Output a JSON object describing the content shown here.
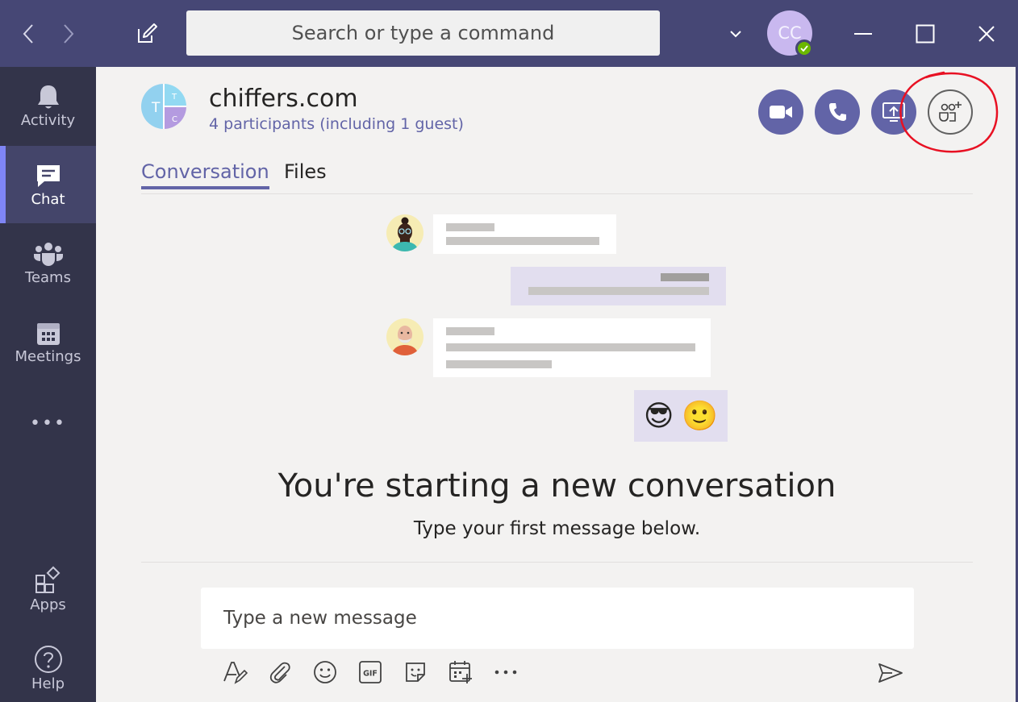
{
  "window": {
    "search_placeholder": "Search or type a command",
    "user_initials": "CC"
  },
  "colors": {
    "titlebar": "#464775",
    "rail": "#33344a",
    "accent": "#6264a7",
    "presence": "#6bb700",
    "annotation": "#e81123"
  },
  "rail": {
    "items": [
      {
        "label": "Activity",
        "icon": "bell-icon"
      },
      {
        "label": "Chat",
        "icon": "chat-icon"
      },
      {
        "label": "Teams",
        "icon": "teams-icon"
      },
      {
        "label": "Meetings",
        "icon": "calendar-icon"
      },
      {
        "label": "Apps",
        "icon": "apps-icon"
      },
      {
        "label": "Help",
        "icon": "help-icon"
      }
    ],
    "more_label": "•••"
  },
  "chat": {
    "group_initials": [
      "T",
      "T",
      "C"
    ],
    "title": "chiffers.com",
    "participants": "4 participants (including 1 guest)",
    "actions": [
      "video-call-icon",
      "audio-call-icon",
      "share-screen-icon",
      "add-people-icon"
    ]
  },
  "tabs": [
    {
      "label": "Conversation",
      "active": true
    },
    {
      "label": "Files",
      "active": false
    }
  ],
  "empty_state": {
    "title": "You're starting a new conversation",
    "subtitle": "Type your first message below.",
    "emojis": [
      "😎",
      "🙂"
    ]
  },
  "compose": {
    "placeholder": "Type a new message",
    "tools": [
      "format-icon",
      "attach-icon",
      "emoji-icon",
      "gif-icon",
      "sticker-icon",
      "schedule-meeting-icon",
      "more-options-icon"
    ],
    "gif_label": "GIF"
  }
}
